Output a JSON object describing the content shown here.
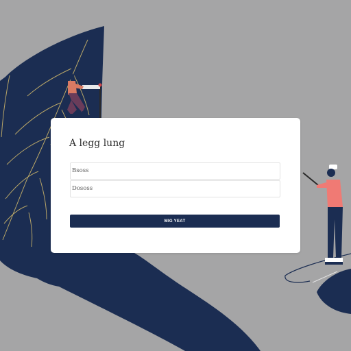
{
  "colors": {
    "background": "#a5a5a6",
    "leaf": "#1b2d52",
    "leaf_vein": "#c9b36a",
    "card": "#ffffff",
    "button": "#1b2d52"
  },
  "card": {
    "title": "A legg lung",
    "field1_placeholder": "Bsoss",
    "field2_placeholder": "Dososs",
    "button_label": "MIG YEAT"
  },
  "illustration": {
    "left_figure": "person-with-signpost",
    "right_figure": "person-with-pointer",
    "leaf": "large-dark-leaf"
  }
}
